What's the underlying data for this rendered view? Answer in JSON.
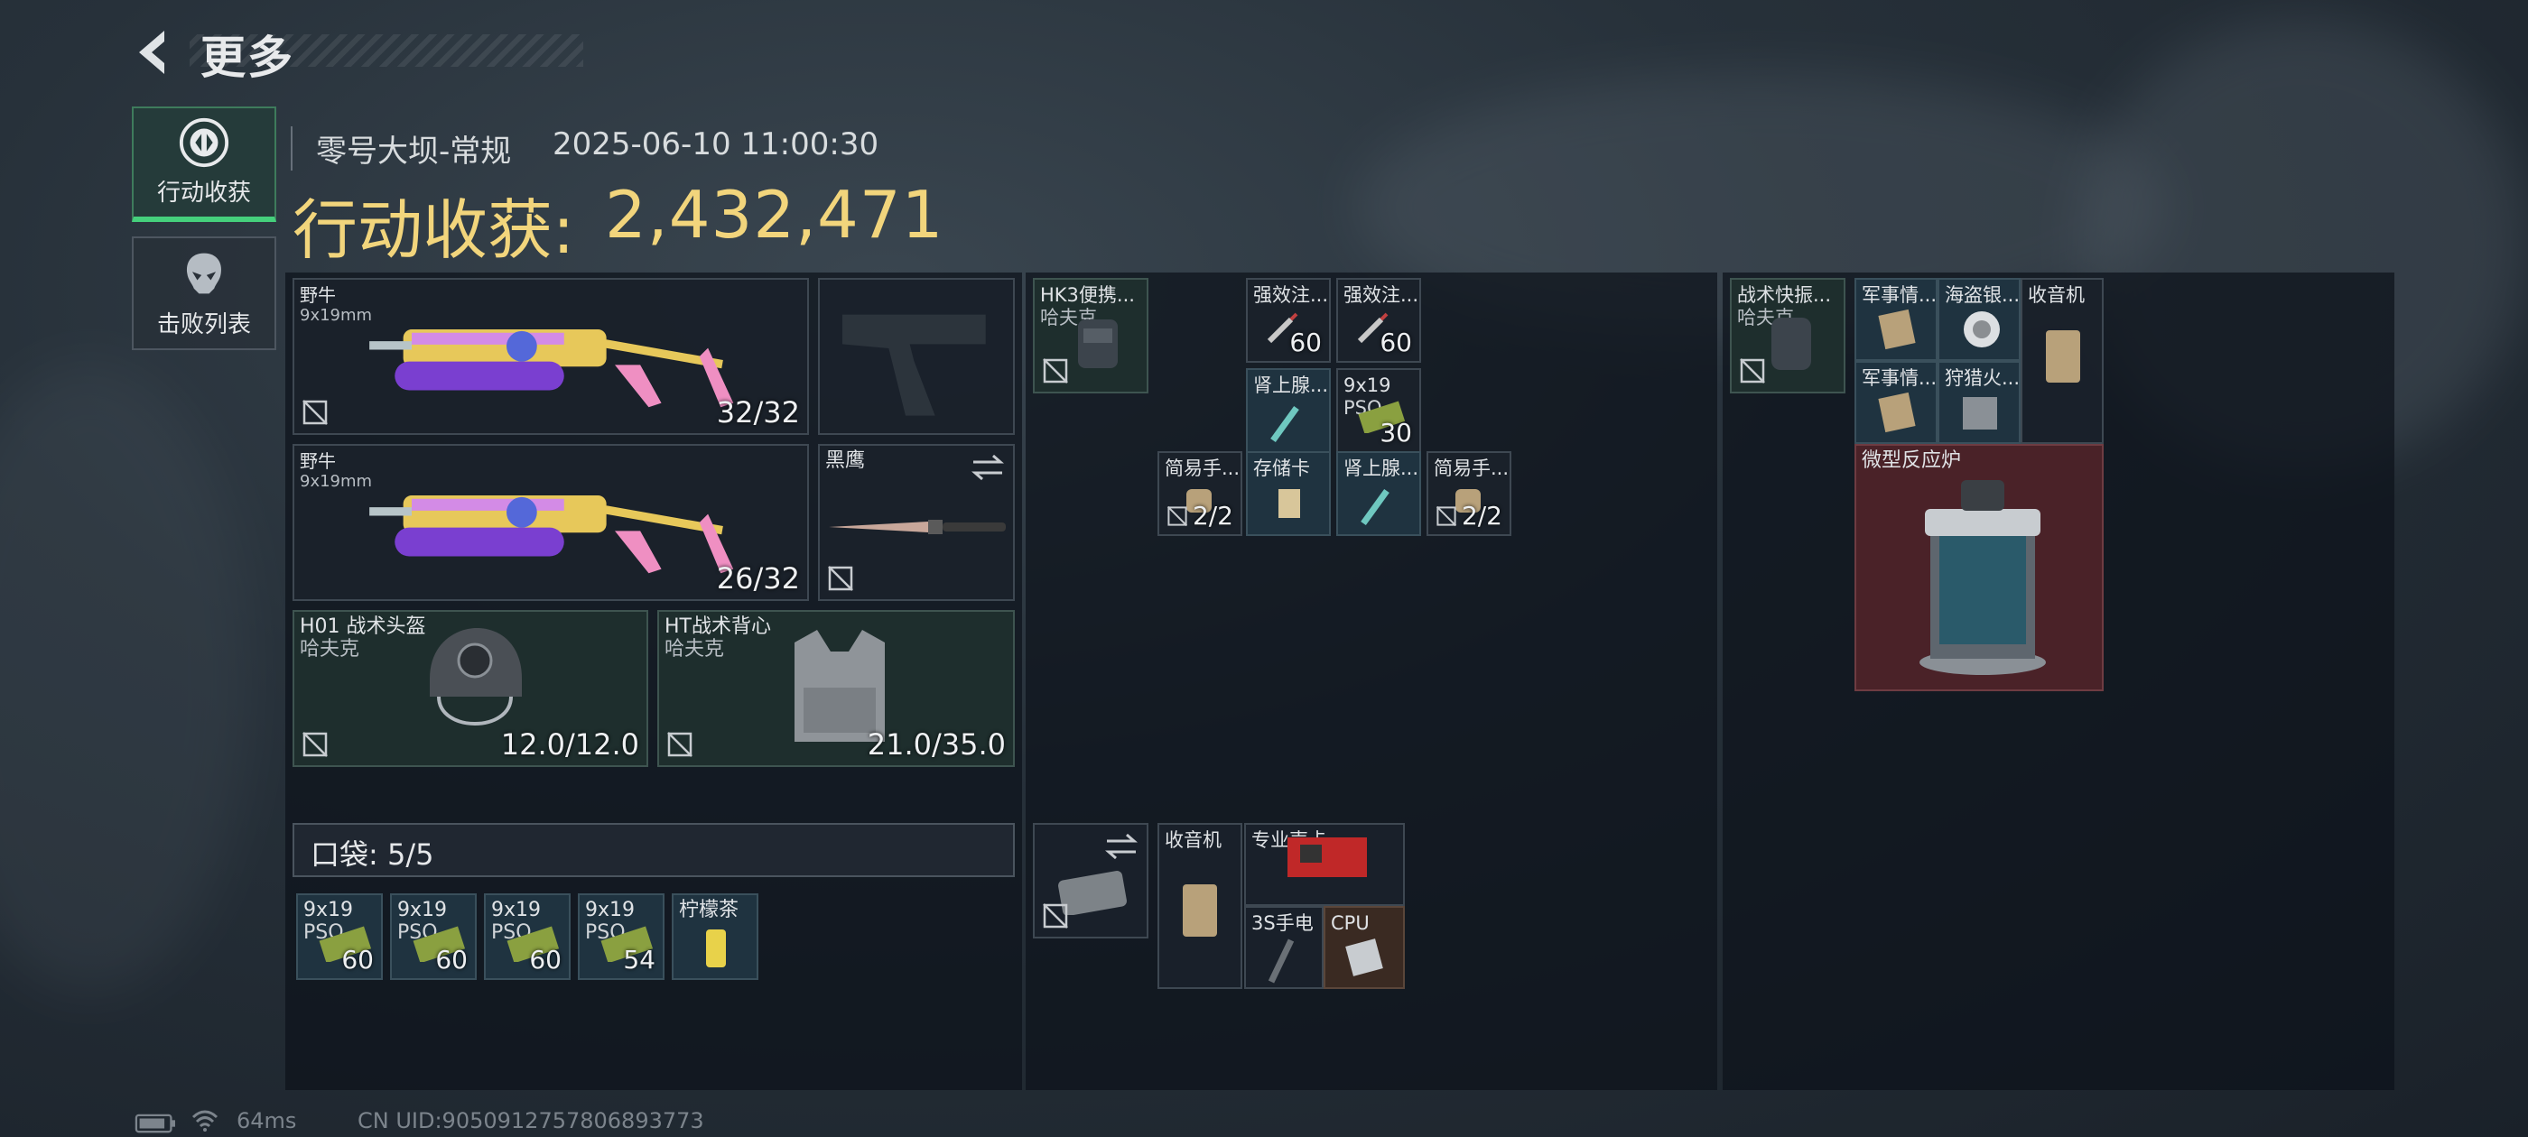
{
  "header": {
    "back_icon": "chevron-left-icon",
    "title": "更多"
  },
  "nav": {
    "tab_haul": {
      "label": "行动收获",
      "icon": "dfcoin-icon"
    },
    "tab_kills": {
      "label": "击败列表",
      "icon": "skull-icon"
    }
  },
  "raid": {
    "map": "零号大坝-常规",
    "datetime": "2025-06-10 11:00:30",
    "haul_label": "行动收获:",
    "haul_value": "2,432,471"
  },
  "loadout": {
    "primary1": {
      "name": "野牛",
      "ammo": "9x19mm",
      "count": "32/32"
    },
    "primary2": {
      "name": "野牛",
      "ammo": "9x19mm",
      "count": "26/32"
    },
    "melee": {
      "name": "黑鹰"
    },
    "helmet": {
      "name": "H01 战术头盔",
      "brand": "哈夫克",
      "durability": "12.0/12.0"
    },
    "armor": {
      "name": "HT战术背心",
      "brand": "哈夫克",
      "durability": "21.0/35.0"
    }
  },
  "pocket": {
    "label": "口袋:",
    "count": "5/5",
    "items": [
      {
        "l1": "9x19",
        "l2": "PSO",
        "count": "60"
      },
      {
        "l1": "9x19",
        "l2": "PSO",
        "count": "60"
      },
      {
        "l1": "9x19",
        "l2": "PSO",
        "count": "60"
      },
      {
        "l1": "9x19",
        "l2": "PSO",
        "count": "54"
      },
      {
        "l1": "柠檬茶",
        "l2": "",
        "count": ""
      }
    ]
  },
  "rig": {
    "name": "HK3便携...",
    "brand": "哈夫克",
    "items": {
      "s1": {
        "name": "强效注...",
        "count": "60"
      },
      "s2": {
        "name": "强效注...",
        "count": "60"
      },
      "s3": {
        "name": "肾上腺..."
      },
      "s4": {
        "l1": "9x19",
        "l2": "PSO",
        "count": "30"
      },
      "s5": {
        "name": "简易手...",
        "count": "2/2"
      },
      "s6": {
        "name": "存储卡"
      },
      "s7": {
        "name": "肾上腺..."
      },
      "s8": {
        "name": "简易手...",
        "count": "2/2"
      }
    }
  },
  "case": {
    "items": {
      "c1": {
        "name": "收音机"
      },
      "c2": {
        "name": "专业声卡"
      },
      "c3": {
        "name": "3S手电"
      },
      "c4": {
        "name": "CPU"
      }
    }
  },
  "backpack": {
    "name": "战术快振...",
    "brand": "哈夫克",
    "items": {
      "b1": {
        "name": "军事情..."
      },
      "b2": {
        "name": "海盗银..."
      },
      "b3": {
        "name": "收音机"
      },
      "b4": {
        "name": "军事情..."
      },
      "b5": {
        "name": "狩猎火..."
      },
      "b6": {
        "name": "微型反应炉"
      }
    }
  },
  "status": {
    "ping": "64ms",
    "uid": "CN UID:9050912757806893773"
  },
  "colors": {
    "accent_gold": "#f2d57c",
    "tab_active": "#45d07c",
    "legendary_red": "#4a2228"
  }
}
